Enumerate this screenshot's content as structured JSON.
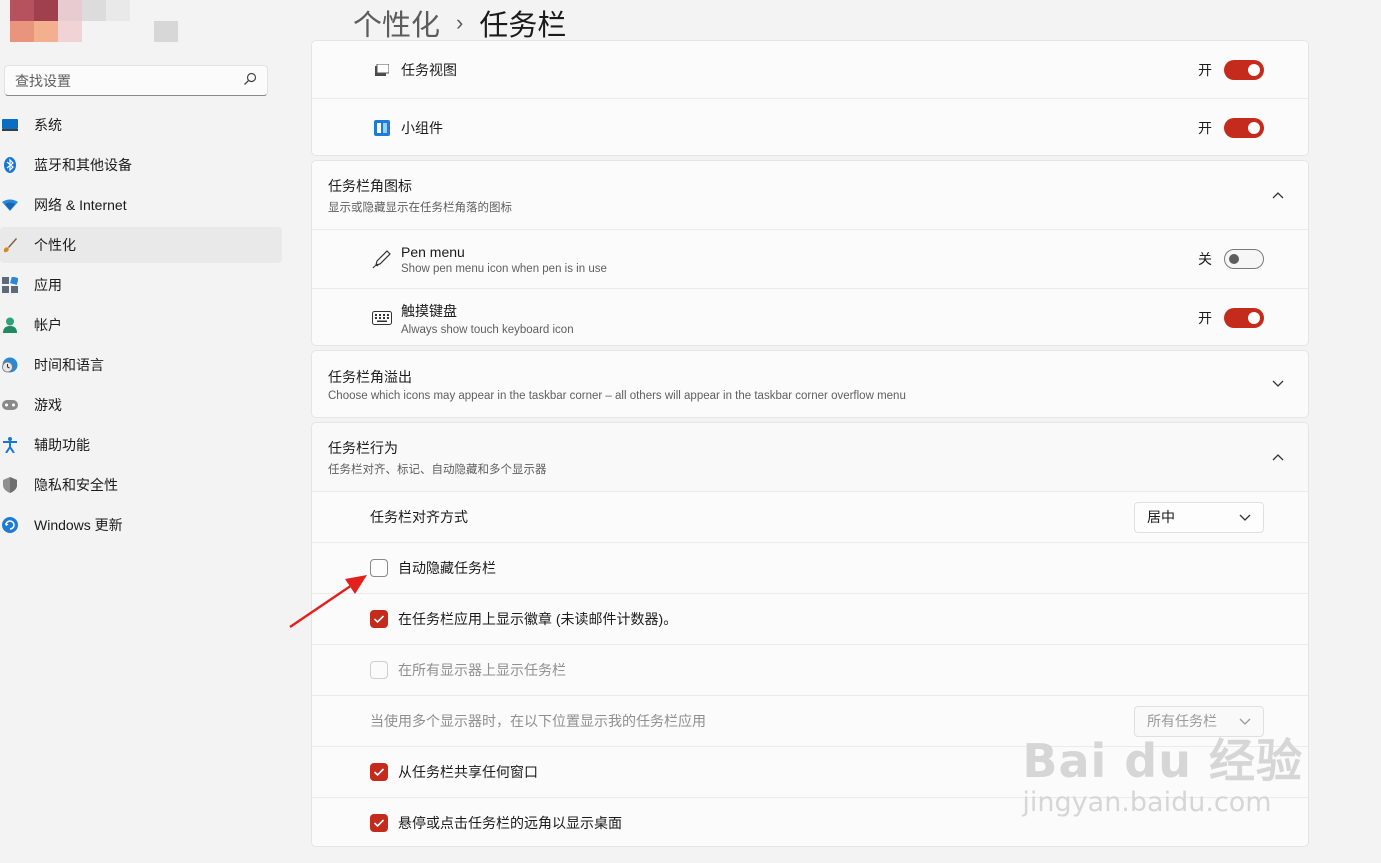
{
  "header": {
    "breadcrumb_parent": "个性化",
    "breadcrumb_separator": "›",
    "breadcrumb_current": "任务栏"
  },
  "sidebar": {
    "search_placeholder": "查找设置",
    "items": [
      {
        "label": "系统",
        "icon": "system-icon"
      },
      {
        "label": "蓝牙和其他设备",
        "icon": "bluetooth-icon"
      },
      {
        "label": "网络 & Internet",
        "icon": "wifi-icon"
      },
      {
        "label": "个性化",
        "icon": "brush-icon",
        "active": true
      },
      {
        "label": "应用",
        "icon": "apps-icon"
      },
      {
        "label": "帐户",
        "icon": "account-icon"
      },
      {
        "label": "时间和语言",
        "icon": "time-language-icon"
      },
      {
        "label": "游戏",
        "icon": "gamepad-icon"
      },
      {
        "label": "辅助功能",
        "icon": "accessibility-icon"
      },
      {
        "label": "隐私和安全性",
        "icon": "shield-icon"
      },
      {
        "label": "Windows 更新",
        "icon": "update-icon"
      }
    ]
  },
  "taskbar_items": [
    {
      "label": "任务视图",
      "state": "开",
      "on": true,
      "icon": "task-view-icon"
    },
    {
      "label": "小组件",
      "state": "开",
      "on": true,
      "icon": "widgets-icon"
    }
  ],
  "corner_icons": {
    "title": "任务栏角图标",
    "subtitle": "显示或隐藏显示在任务栏角落的图标",
    "items": [
      {
        "label": "Pen menu",
        "sub": "Show pen menu icon when pen is in use",
        "state": "关",
        "on": false,
        "icon": "pen-icon"
      },
      {
        "label": "触摸键盘",
        "sub": "Always show touch keyboard icon",
        "state": "开",
        "on": true,
        "icon": "keyboard-icon"
      }
    ]
  },
  "corner_overflow": {
    "title": "任务栏角溢出",
    "subtitle": "Choose which icons may appear in the taskbar corner – all others will appear in the taskbar corner overflow menu"
  },
  "behaviors": {
    "title": "任务栏行为",
    "subtitle": "任务栏对齐、标记、自动隐藏和多个显示器",
    "alignment_label": "任务栏对齐方式",
    "alignment_value": "居中",
    "auto_hide": "自动隐藏任务栏",
    "badges": "在任务栏应用上显示徽章 (未读邮件计数器)。",
    "all_displays": "在所有显示器上显示任务栏",
    "multi_display_label": "当使用多个显示器时，在以下位置显示我的任务栏应用",
    "multi_display_value": "所有任务栏",
    "share_window": "从任务栏共享任何窗口",
    "far_corner": "悬停或点击任务栏的远角以显示桌面",
    "checkbox_states": {
      "auto_hide": false,
      "badges": true,
      "all_displays": false,
      "share_window": true,
      "far_corner": true
    }
  },
  "watermark": {
    "line1": "Bai du 经验",
    "line2": "jingyan.baidu.com"
  },
  "colors": {
    "accent": "#c42b1c",
    "background": "#f3f3f3",
    "card": "#fbfbfb",
    "annotation_arrow": "#e3201b"
  }
}
